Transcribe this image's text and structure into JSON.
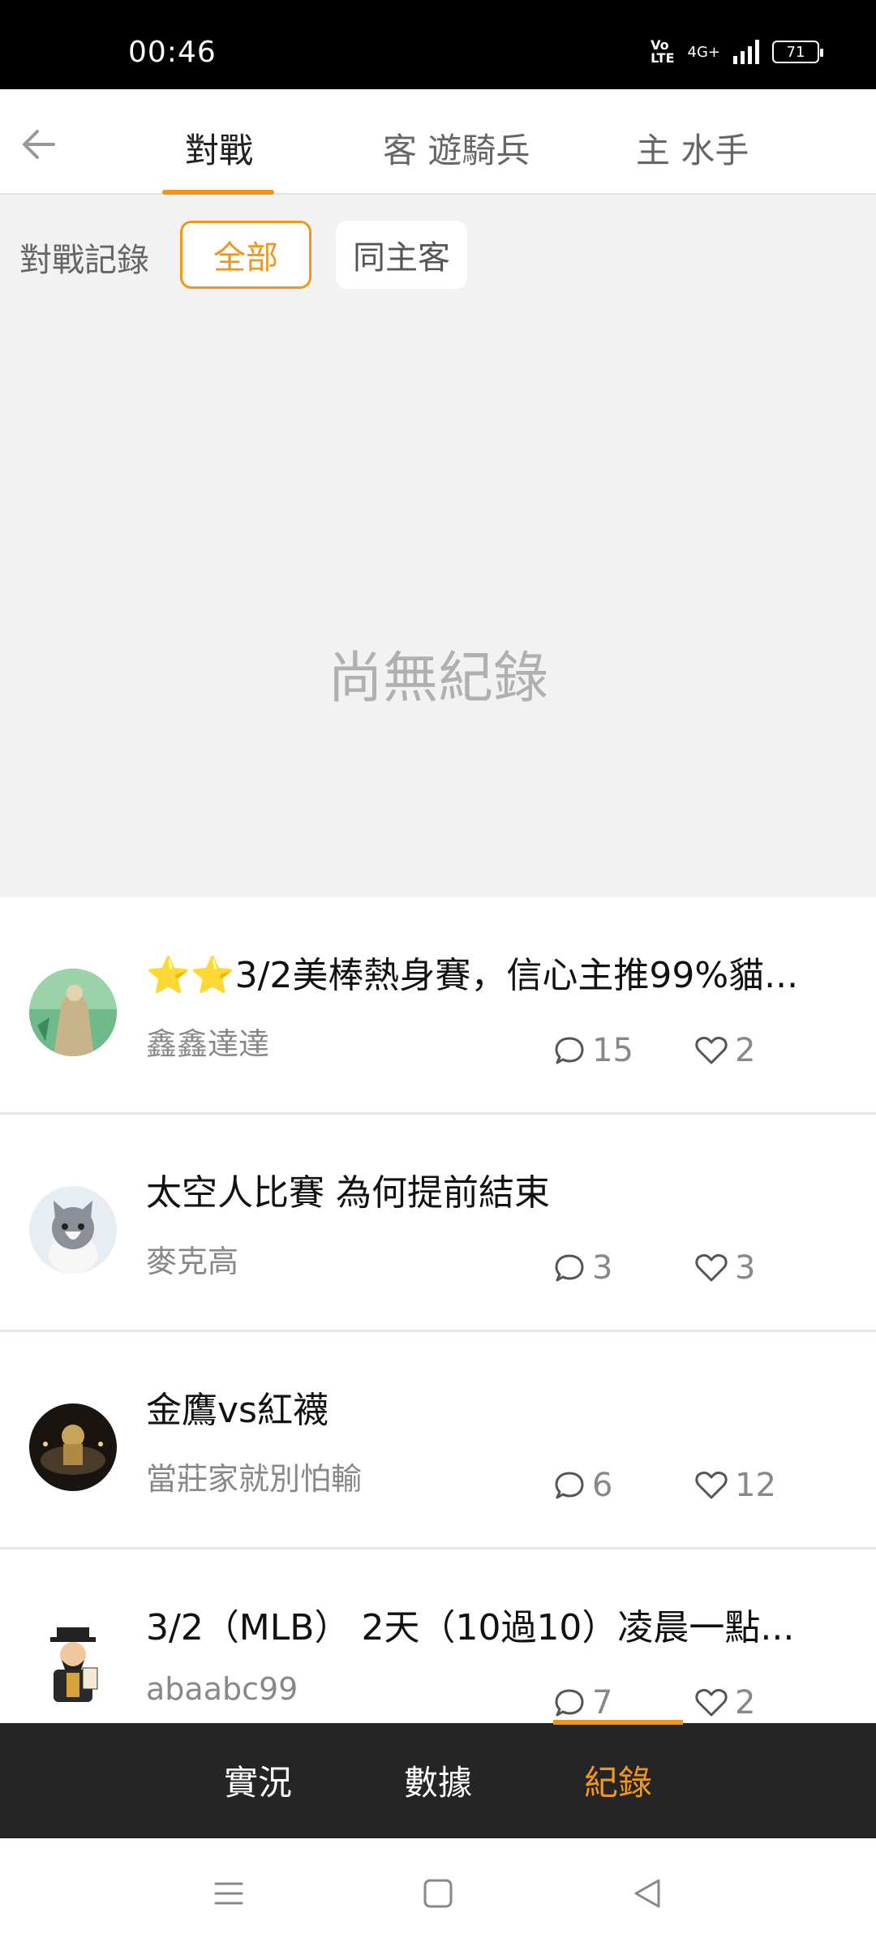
{
  "status": {
    "time": "00:46",
    "volte": "Vo\nLTE",
    "network": "4G+",
    "battery": "71"
  },
  "header": {
    "back_icon": "back-arrow-icon",
    "tabs": [
      {
        "label": "對戰",
        "active": true
      },
      {
        "label": "客 遊騎兵",
        "active": false
      },
      {
        "label": "主 水手",
        "active": false
      }
    ]
  },
  "filter": {
    "label": "對戰記錄",
    "chips": [
      {
        "label": "全部",
        "selected": true
      },
      {
        "label": "同主客",
        "selected": false
      }
    ],
    "empty_message": "尚無紀錄"
  },
  "posts": [
    {
      "title": "⭐⭐3/2美棒熱身賽，信心主推99%貓...",
      "author": "鑫鑫達達",
      "comments": "15",
      "likes": "2"
    },
    {
      "title": "太空人比賽 為何提前結束",
      "author": "麥克高",
      "comments": "3",
      "likes": "3"
    },
    {
      "title": "金鷹vs紅襪",
      "author": "當莊家就別怕輸",
      "comments": "6",
      "likes": "12"
    },
    {
      "title": "3/2（MLB） 2天（10過10）凌晨一點...",
      "author": "abaabc99",
      "comments": "7",
      "likes": "2"
    }
  ],
  "bottom_nav": {
    "items": [
      {
        "label": "實況",
        "active": false
      },
      {
        "label": "數據",
        "active": false
      },
      {
        "label": "紀錄",
        "active": true
      }
    ]
  },
  "colors": {
    "accent": "#f0961e",
    "nav_bg": "#252525",
    "filter_bg": "#f2f2f2"
  }
}
